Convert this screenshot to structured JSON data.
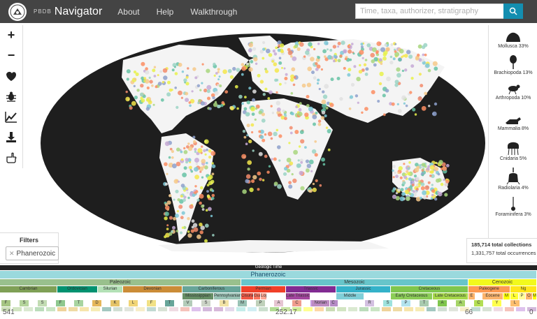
{
  "nav": {
    "brand_small": "PBDB",
    "brand_big": "Navigator",
    "links": [
      "About",
      "Help",
      "Walkthrough"
    ],
    "search_placeholder": "Time, taxa, authorizer, stratigraphy"
  },
  "toolbar": {
    "icons": [
      "zoom-in-icon",
      "zoom-out-icon",
      "map-layers-icon",
      "taxa-bug-icon",
      "diversity-curve-icon",
      "download-icon",
      "hand-pointer-icon"
    ],
    "zoom_in": "+",
    "zoom_out": "−"
  },
  "colors": {
    "navbar": "#444444",
    "ocean": "#1e1e1e",
    "land": "#ffffff",
    "search_button": "#138eb0"
  },
  "taxa": [
    {
      "label": "Mollusca 33%",
      "icon": "mollusca-icon"
    },
    {
      "label": "Brachiopoda 13%",
      "icon": "brachiopoda-icon"
    },
    {
      "label": "Arthropoda 10%",
      "icon": "arthropoda-icon"
    },
    {
      "label": "Mammalia 8%",
      "icon": "mammalia-icon"
    },
    {
      "label": "Cnidaria 5%",
      "icon": "cnidaria-icon"
    },
    {
      "label": "Radiolaria 4%",
      "icon": "radiolaria-icon"
    },
    {
      "label": "Foraminifera 3%",
      "icon": "foraminifera-icon"
    }
  ],
  "filters": {
    "title": "Filters",
    "active": "Phanerozoic"
  },
  "stats": {
    "collections": "185,714 total collections",
    "occurrences": "1,331,757 total occurrences"
  },
  "timescale": {
    "title": "Geologic Time",
    "eon": "Phanerozoic",
    "eras": [
      {
        "name": "Paleozoic",
        "color": "#99c08d"
      },
      {
        "name": "Mesozoic",
        "color": "#67c5ca"
      },
      {
        "name": "Cenozoic",
        "color": "#f2f91d"
      }
    ],
    "periods": [
      {
        "name": "Cambrian",
        "color": "#7fa056"
      },
      {
        "name": "Ordovician",
        "color": "#009270"
      },
      {
        "name": "Silurian",
        "color": "#b3e1b6"
      },
      {
        "name": "Devonian",
        "color": "#cb8c37"
      },
      {
        "name": "Carboniferous",
        "color": "#67a599"
      },
      {
        "name": "Permian",
        "color": "#f04028"
      },
      {
        "name": "Triassic",
        "color": "#812b92"
      },
      {
        "name": "Jurassic",
        "color": "#34b2c9"
      },
      {
        "name": "Cretaceous",
        "color": "#7fc64e"
      },
      {
        "name": "Paleogene",
        "color": "#fd9a52"
      },
      {
        "name": "Ng",
        "color": "#ffe619"
      }
    ],
    "epochs": [
      "Mississippian",
      "Pennsylvanian",
      "Cisuralian",
      "Guadalupian",
      "Lopingian",
      "Middle",
      "Late Triassic",
      "Early Cretaceous",
      "Late Cretaceous",
      "Eocene",
      "E",
      "M",
      "L",
      "P",
      "O",
      "M"
    ],
    "stages": [
      "F",
      "S",
      "S",
      "F",
      "T",
      "D",
      "K",
      "L",
      "F",
      "T",
      "V",
      "S",
      "B",
      "M",
      "P",
      "A",
      "C",
      "K",
      "C",
      "Norian",
      "R",
      "S",
      "P",
      "T",
      "A",
      "A",
      "C",
      "Y",
      "L"
    ],
    "axis_labels": [
      "541",
      "252.17",
      "66",
      "0"
    ]
  }
}
